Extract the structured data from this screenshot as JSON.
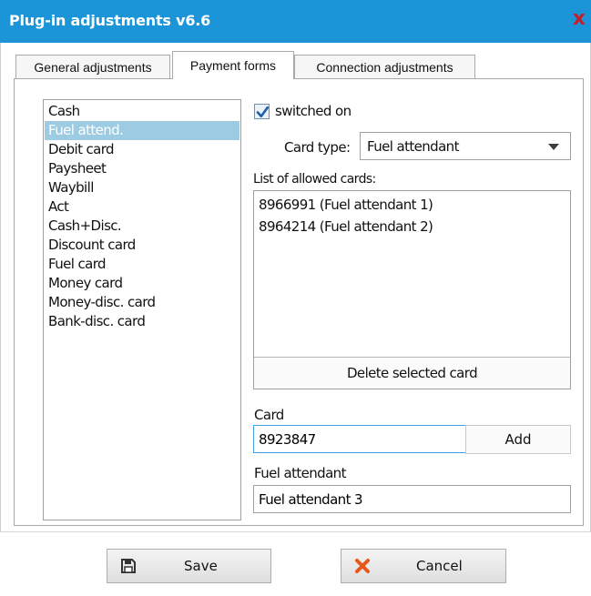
{
  "window": {
    "title": "Plug-in adjustments v6.6",
    "close_glyph": "x"
  },
  "tabs": [
    {
      "label": "General adjustments",
      "active": false
    },
    {
      "label": "Payment forms",
      "active": true
    },
    {
      "label": "Connection adjustments",
      "active": false
    }
  ],
  "payment_forms": {
    "items": [
      "Cash",
      "Fuel attend.",
      "Debit card",
      "Paysheet",
      "Waybill",
      "Act",
      "Cash+Disc.",
      "Discount card",
      "Fuel card",
      "Money card",
      "Money-disc. card",
      "Bank-disc. card"
    ],
    "selected_index": 1
  },
  "settings": {
    "switched_on_label": "switched on",
    "switched_on_checked": true,
    "card_type_label": "Card type:",
    "card_type_value": "Fuel attendant",
    "allowed_cards_label": "List of allowed cards:",
    "allowed_cards": [
      "8966991 (Fuel attendant 1)",
      "8964214 (Fuel attendant 2)"
    ],
    "delete_selected_label": "Delete selected card",
    "card_label": "Card",
    "card_value": "8923847",
    "add_label": "Add",
    "fuel_attendant_label": "Fuel attendant",
    "fuel_attendant_value": "Fuel attendant 3"
  },
  "footer": {
    "save_label": "Save",
    "cancel_label": "Cancel"
  },
  "icons": {
    "close": "close-icon",
    "checkbox": "checkmark-icon",
    "dropdown": "chevron-down-icon",
    "save": "floppy-disk-icon",
    "cancel": "x-icon"
  },
  "colors": {
    "titlebar": "#1c94d8",
    "selection": "#9dcbe1",
    "close": "#c0202a",
    "cancel_icon": "#e8561c",
    "focus_border": "#3b9fe0"
  }
}
